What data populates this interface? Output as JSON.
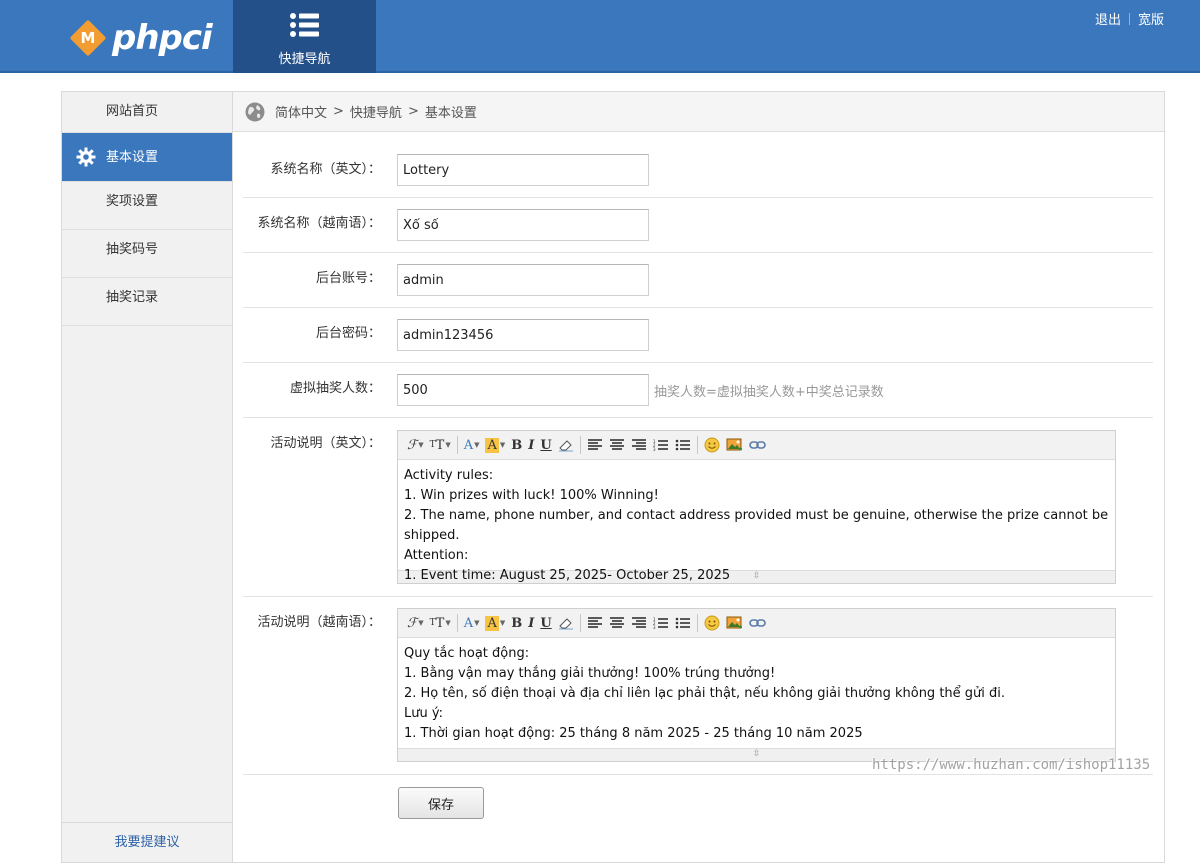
{
  "header": {
    "logo_text": "phpci",
    "logo_mark": "M",
    "nav_tab_label": "快捷导航",
    "links": [
      "退出",
      "宽版"
    ]
  },
  "sidebar": {
    "items": [
      {
        "label": "网站首页"
      },
      {
        "label": "基本设置"
      },
      {
        "label": "奖项设置"
      },
      {
        "label": "抽奖码号"
      },
      {
        "label": "抽奖记录"
      }
    ],
    "suggest": "我要提建议"
  },
  "breadcrumb": {
    "parts": [
      "简体中文",
      "快捷导航",
      "基本设置"
    ],
    "separator": ">"
  },
  "form": {
    "name_en_label": "系统名称（英文）：",
    "name_en_value": "Lottery",
    "name_vi_label": "系统名称（越南语）：",
    "name_vi_value": "Xổ số",
    "account_label": "后台账号：",
    "account_value": "admin",
    "password_label": "后台密码：",
    "password_value": "admin123456",
    "virtual_label": "虚拟抽奖人数：",
    "virtual_value": "500",
    "virtual_hint": "抽奖人数=虚拟抽奖人数+中奖总记录数",
    "desc_en_label": "活动说明（英文）：",
    "desc_en_lines": [
      "Activity rules:",
      "1. Win prizes with luck! 100% Winning!",
      "2. The name, phone number, and contact address provided must be genuine, otherwise the prize cannot be shipped.",
      "Attention:",
      "1. Event time: August 25, 2025- October 25, 2025"
    ],
    "desc_vi_label": "活动说明（越南语）：",
    "desc_vi_lines": [
      "Quy tắc hoạt động:",
      "1. Bằng vận may thắng giải thưởng! 100% trúng thưởng!",
      "2. Họ tên, số điện thoại và địa chỉ liên lạc phải thật, nếu không giải thưởng không thể gửi đi.",
      "Lưu ý:",
      "1. Thời gian hoạt động: 25 tháng 8 năm 2025 - 25 tháng 10 năm 2025"
    ],
    "save_label": "保存"
  },
  "watermark": "https://www.huzhan.com/ishop11135",
  "colors": {
    "brand_blue": "#3a77bd",
    "dark_blue": "#24508a",
    "logo_orange": "#f39c32"
  }
}
